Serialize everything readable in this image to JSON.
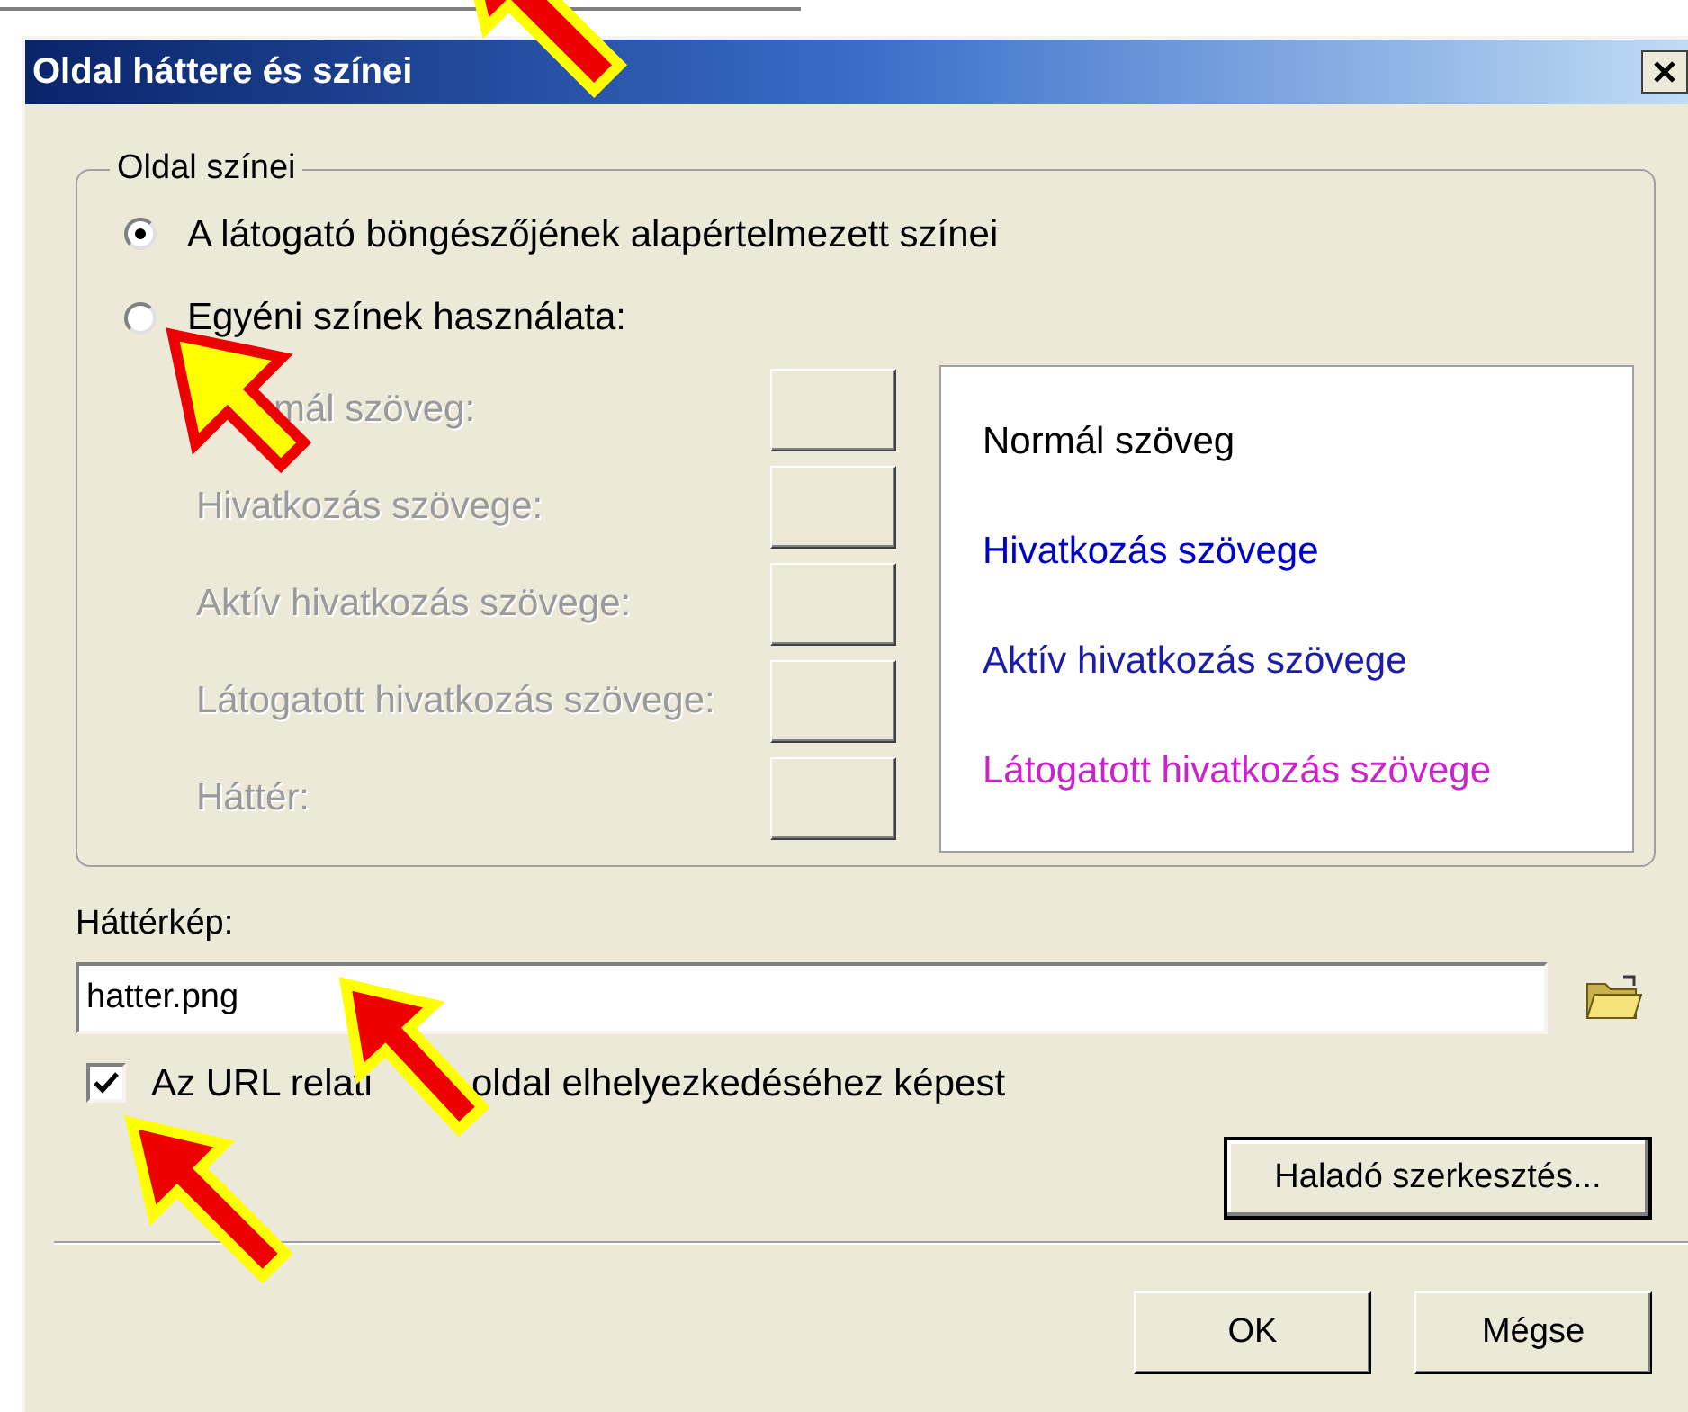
{
  "window": {
    "title": "Oldal háttere és színei"
  },
  "colors_group": {
    "title": "Oldal színei",
    "options": [
      {
        "label": "A látogató böngészőjének alapértelmezett színei",
        "selected": true
      },
      {
        "label": "Egyéni színek használata:",
        "selected": false
      }
    ],
    "color_rows": [
      {
        "label": "mál szöveg:",
        "disabled": true
      },
      {
        "label": "Hivatkozás szövege:",
        "disabled": true
      },
      {
        "label": "Aktív hivatkozás szövege:",
        "disabled": true
      },
      {
        "label": "Látogatott hivatkozás szövege:",
        "disabled": true
      },
      {
        "label": "Háttér:",
        "disabled": true
      }
    ],
    "preview": [
      {
        "text": "Normál szöveg",
        "color": "#000000"
      },
      {
        "text": "Hivatkozás szövege",
        "color": "#0000cc"
      },
      {
        "text": "Aktív hivatkozás szövege",
        "color": "#1c1ca8"
      },
      {
        "text": "Látogatott hivatkozás szövege",
        "color": "#cc22cc"
      }
    ]
  },
  "background_image": {
    "label": "Háttérkép:",
    "value": "hatter.png"
  },
  "relative_url": {
    "checked": true,
    "label_parts": [
      "Az URL relati",
      "oldal elhelyezkedéséhez képest"
    ]
  },
  "advanced_button": "Haladó szerkesztés...",
  "buttons": [
    "OK",
    "Mégse"
  ]
}
